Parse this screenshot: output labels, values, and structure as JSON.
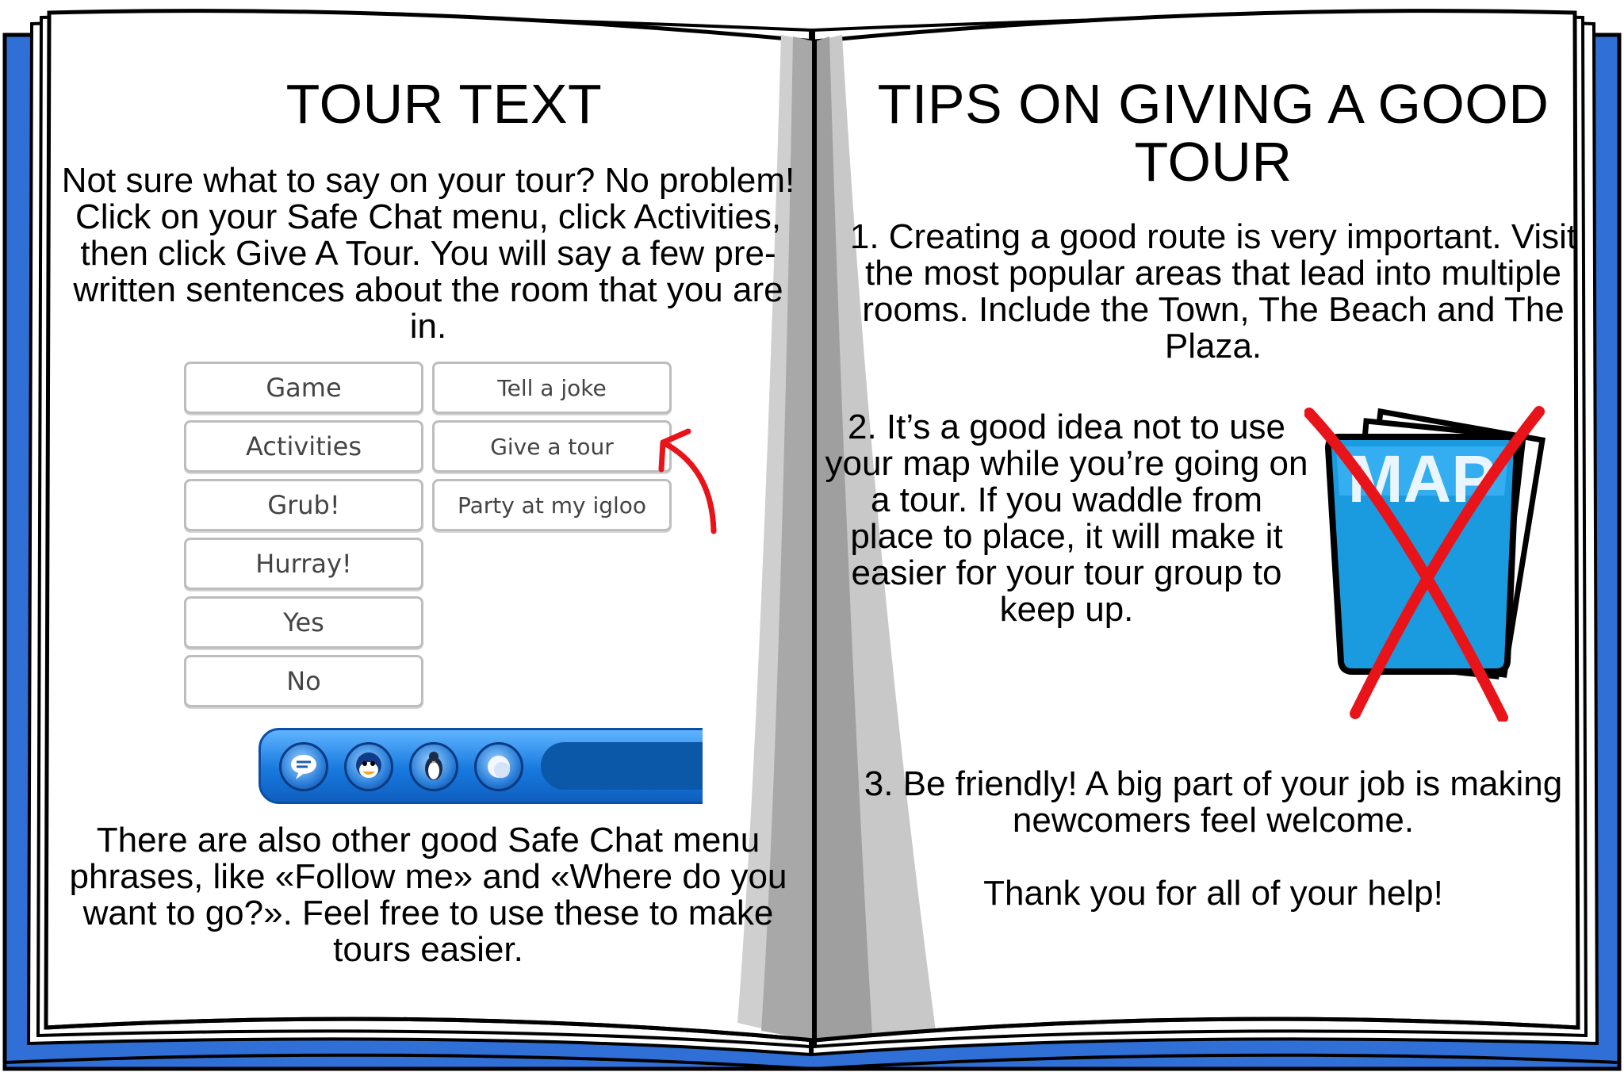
{
  "left_page": {
    "title": "TOUR TEXT",
    "intro": "Not sure what to say on your tour? No problem! Click on your Safe Chat menu, click Activities, then click Give A Tour. You will say a few pre-written sentences about the room that you are in.",
    "safe_chat_menu": {
      "main_items": [
        "Game",
        "Activities",
        "Grub!",
        "Hurray!",
        "Yes",
        "No"
      ],
      "submenu_items": [
        "Tell a joke",
        "Give a tour",
        "Party at my igloo"
      ],
      "highlighted_item": "Give a tour"
    },
    "toolbar_icons": [
      "speech-bubble-icon",
      "penguin-face-icon",
      "penguin-icon",
      "snowball-icon"
    ],
    "outro": "There are also other good Safe Chat menu phrases, like «Follow me» and «Where do you want to go?». Feel free to use these to make tours easier."
  },
  "right_page": {
    "title": "TIPS ON GIVING A GOOD TOUR",
    "tip1": "1. Creating a good route is very important. Visit the most popular areas that lead into multiple rooms. Include the Town, The Beach and The Plaza.",
    "tip2": "2. It’s a good idea not to use your map while you’re going on a tour. If you waddle from place to place, it will make it easier for your tour group to keep up.",
    "map_label": "MAP",
    "tip3": "3. Be friendly! A big part of your job is making newcomers feel welcome.",
    "thanks": "Thank you for all of your help!"
  },
  "colors": {
    "book_cover": "#2f6fd6",
    "spine_shadow": "#9e9e9e",
    "annotation_red": "#e8141a",
    "map_blue": "#1a9be0"
  }
}
